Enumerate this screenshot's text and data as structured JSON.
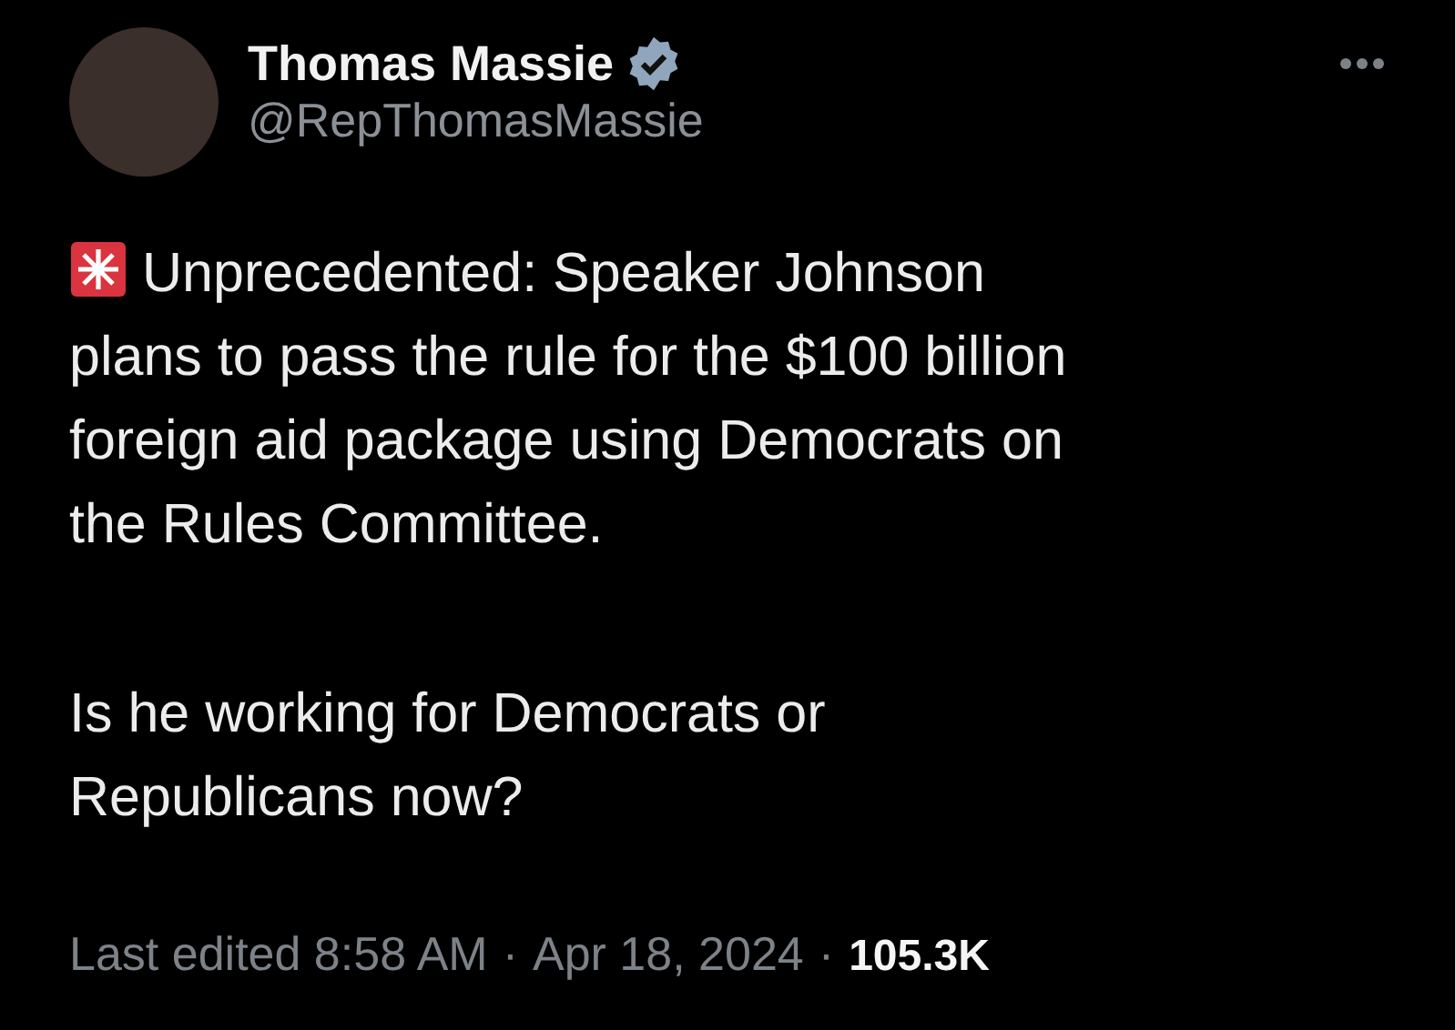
{
  "author": {
    "name": "Thomas Massie",
    "verified": true,
    "handle": "@RepThomasMassie"
  },
  "paragraphs": [
    {
      "lines": [
        "Unprecedented: Speaker Johnson",
        "plans to pass the rule for the $100 billion",
        "foreign aid package using Democrats on",
        "the Rules Committee."
      ],
      "kind": "alert"
    },
    {
      "kind": "plain",
      "lines": [
        "Is he working for Democrats or",
        "Republicans now?"
      ]
    }
  ],
  "footer": {
    "edited": "Last edited 8:58 AM",
    "separator_1": "·",
    "date": "Apr 18, 2024",
    "separator_2": "·",
    "views": "105.3K"
  }
}
